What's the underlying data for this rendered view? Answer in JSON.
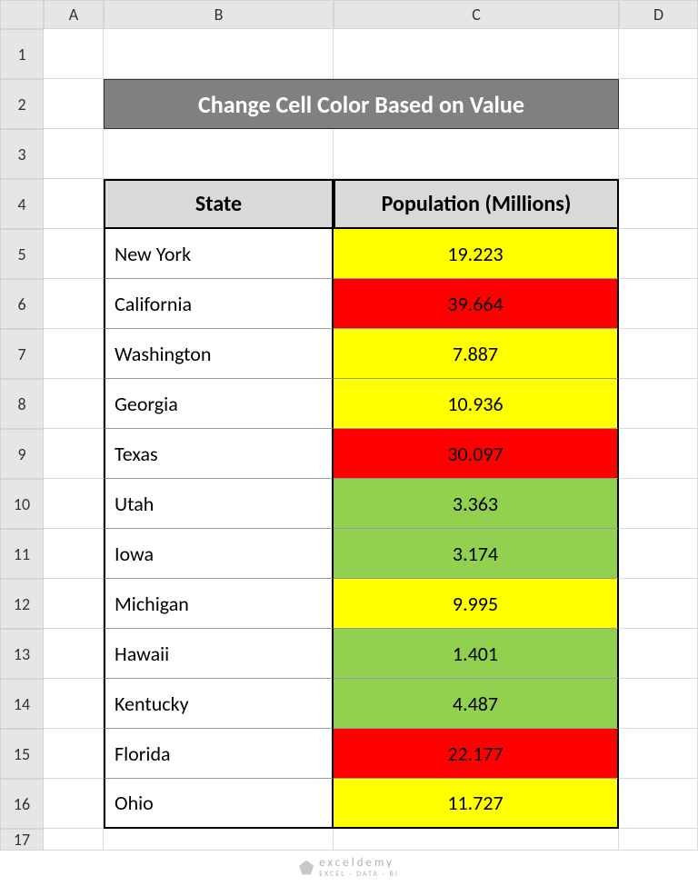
{
  "column_headers": [
    "A",
    "B",
    "C",
    "D"
  ],
  "row_headers": [
    "1",
    "2",
    "3",
    "4",
    "5",
    "6",
    "7",
    "8",
    "9",
    "10",
    "11",
    "12",
    "13",
    "14",
    "15",
    "16",
    "17"
  ],
  "title": "Change Cell Color Based on Value",
  "table": {
    "header_state": "State",
    "header_pop": "Population (Millions)",
    "rows": [
      {
        "state": "New York",
        "pop": "19.223",
        "color": "yellow"
      },
      {
        "state": "California",
        "pop": "39.664",
        "color": "red"
      },
      {
        "state": "Washington",
        "pop": "7.887",
        "color": "yellow"
      },
      {
        "state": "Georgia",
        "pop": "10.936",
        "color": "yellow"
      },
      {
        "state": "Texas",
        "pop": "30.097",
        "color": "red"
      },
      {
        "state": "Utah",
        "pop": "3.363",
        "color": "green"
      },
      {
        "state": "Iowa",
        "pop": "3.174",
        "color": "green"
      },
      {
        "state": "Michigan",
        "pop": "9.995",
        "color": "yellow"
      },
      {
        "state": "Hawaii",
        "pop": "1.401",
        "color": "green"
      },
      {
        "state": "Kentucky",
        "pop": "4.487",
        "color": "green"
      },
      {
        "state": "Florida",
        "pop": "22.177",
        "color": "red"
      },
      {
        "state": "Ohio",
        "pop": "11.727",
        "color": "yellow"
      }
    ]
  },
  "watermark": {
    "brand": "exceldemy",
    "tag": "EXCEL · DATA · BI"
  }
}
